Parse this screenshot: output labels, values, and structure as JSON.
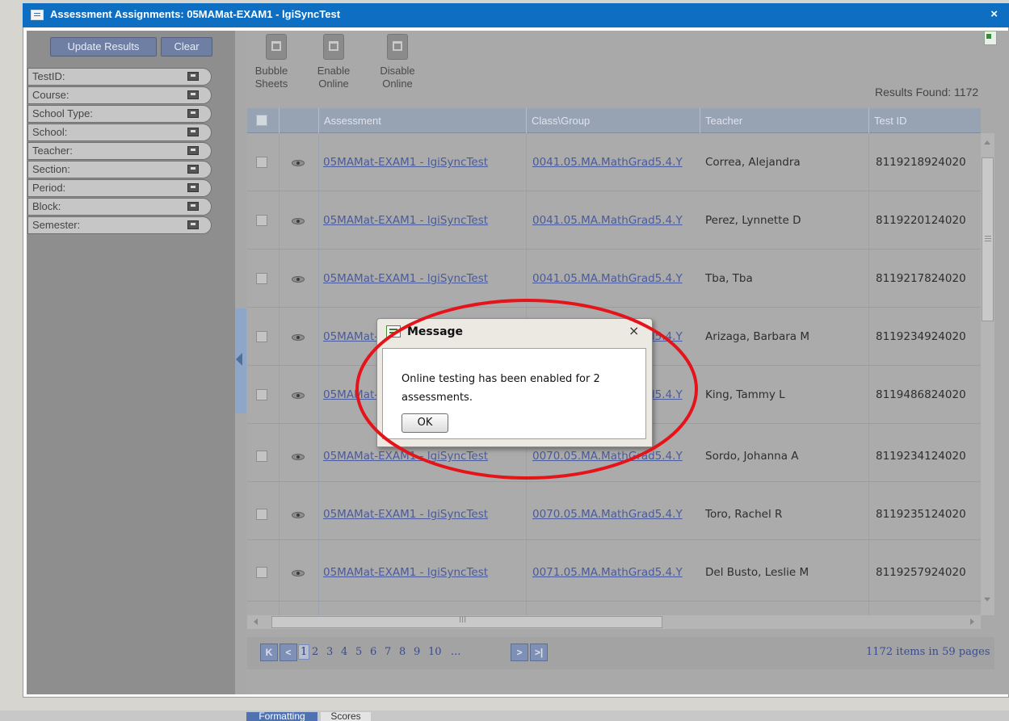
{
  "window": {
    "title": "Assessment Assignments: 05MAMat-EXAM1 - lgiSyncTest",
    "close": "×"
  },
  "left_panel": {
    "update_label": "Update Results",
    "clear_label": "Clear",
    "filters": [
      "TestID:",
      "Course:",
      "School Type:",
      "School:",
      "Teacher:",
      "Section:",
      "Period:",
      "Block:",
      "Semester:"
    ]
  },
  "toolbar": {
    "bubble_sheets": [
      "Bubble",
      "Sheets"
    ],
    "enable_online": [
      "Enable",
      "Online"
    ],
    "disable_online": [
      "Disable",
      "Online"
    ],
    "results_found": "Results Found: 1172"
  },
  "grid": {
    "columns": [
      "Assessment",
      "Class\\Group",
      "Teacher",
      "Test ID"
    ],
    "rows": [
      {
        "assessment": "05MAMat-EXAM1 - lgiSyncTest",
        "class_group": "0041.05.MA.MathGrad5.4.Y",
        "teacher": "Correa, Alejandra",
        "test_id": "8119218924020"
      },
      {
        "assessment": "05MAMat-EXAM1 - lgiSyncTest",
        "class_group": "0041.05.MA.MathGrad5.4.Y",
        "teacher": "Perez, Lynnette D",
        "test_id": "8119220124020"
      },
      {
        "assessment": "05MAMat-EXAM1 - lgiSyncTest",
        "class_group": "0041.05.MA.MathGrad5.4.Y",
        "teacher": "Tba, Tba",
        "test_id": "8119217824020"
      },
      {
        "assessment": "05MAMat-EXAM1 - lgiSyncTest",
        "class_group": "0041.05.MA.MathGrad5.4.Y",
        "teacher": "Arizaga, Barbara M",
        "test_id": "8119234924020"
      },
      {
        "assessment": "05MAMat-EXAM1 - lgiSyncTest",
        "class_group": "0041.05.MA.MathGrad5.4.Y",
        "teacher": "King, Tammy L",
        "test_id": "8119486824020"
      },
      {
        "assessment": "05MAMat-EXAM1 - lgiSyncTest",
        "class_group": "0070.05.MA.MathGrad5.4.Y",
        "teacher": "Sordo, Johanna A",
        "test_id": "8119234124020"
      },
      {
        "assessment": "05MAMat-EXAM1 - lgiSyncTest",
        "class_group": "0070.05.MA.MathGrad5.4.Y",
        "teacher": "Toro, Rachel R",
        "test_id": "8119235124020"
      },
      {
        "assessment": "05MAMat-EXAM1 - lgiSyncTest",
        "class_group": "0071.05.MA.MathGrad5.4.Y",
        "teacher": "Del Busto, Leslie M",
        "test_id": "8119257924020"
      }
    ]
  },
  "pager": {
    "first": "K",
    "prev": "<",
    "next": ">",
    "last": ">|",
    "pages": [
      "1",
      "2",
      "3",
      "4",
      "5",
      "6",
      "7",
      "8",
      "9",
      "10",
      "..."
    ],
    "current": "1",
    "info": "1172 items in 59 pages",
    "hscroll_grip": "III"
  },
  "dialog": {
    "title": "Message",
    "message": "Online testing has been enabled for 2 assessments.",
    "ok_label": "OK",
    "close": "×"
  },
  "bottom_tabs": [
    "Formatting",
    "Scores"
  ],
  "colors": {
    "titlebar": "#0e6fc2",
    "annotation": "#e5141a",
    "link": "#4a5b9c"
  }
}
